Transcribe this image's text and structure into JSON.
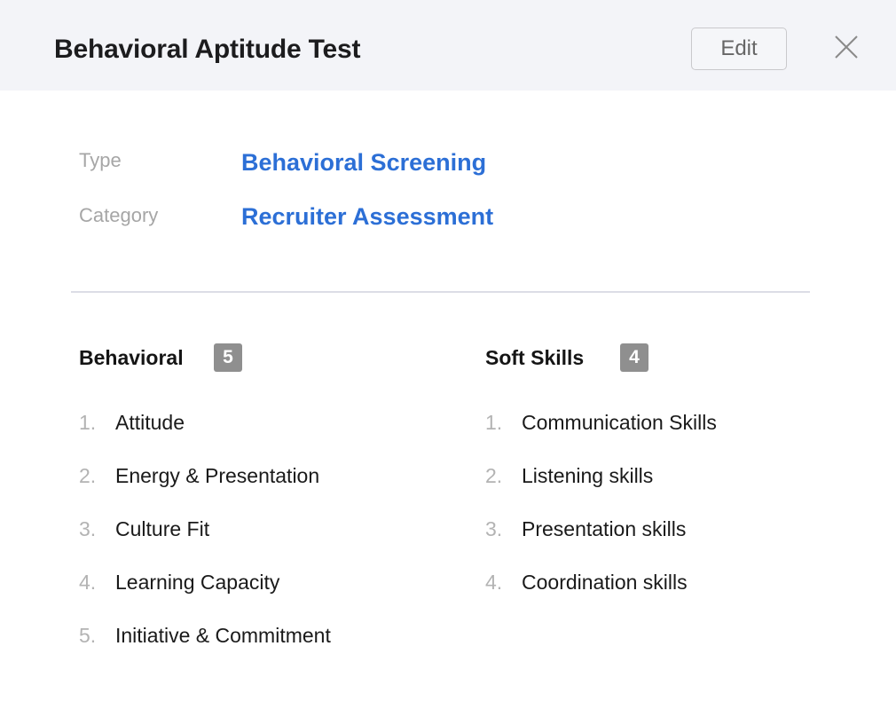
{
  "header": {
    "title": "Behavioral Aptitude Test",
    "edit_label": "Edit",
    "close_icon": "close-icon"
  },
  "meta": {
    "type_label": "Type",
    "type_value": "Behavioral Screening",
    "category_label": "Category",
    "category_value": "Recruiter Assessment"
  },
  "colors": {
    "accent": "#2c6fd6",
    "header_bg": "#f3f4f8",
    "badge_bg": "#8f8f8f"
  },
  "sections": [
    {
      "title": "Behavioral",
      "count": "5",
      "items": [
        {
          "num": "1.",
          "label": "Attitude"
        },
        {
          "num": "2.",
          "label": "Energy & Presentation"
        },
        {
          "num": "3.",
          "label": "Culture Fit"
        },
        {
          "num": "4.",
          "label": "Learning Capacity"
        },
        {
          "num": "5.",
          "label": "Initiative & Commitment"
        }
      ]
    },
    {
      "title": "Soft Skills",
      "count": "4",
      "items": [
        {
          "num": "1.",
          "label": "Communication Skills"
        },
        {
          "num": "2.",
          "label": "Listening skills"
        },
        {
          "num": "3.",
          "label": "Presentation skills"
        },
        {
          "num": "4.",
          "label": "Coordination skills"
        }
      ]
    }
  ]
}
